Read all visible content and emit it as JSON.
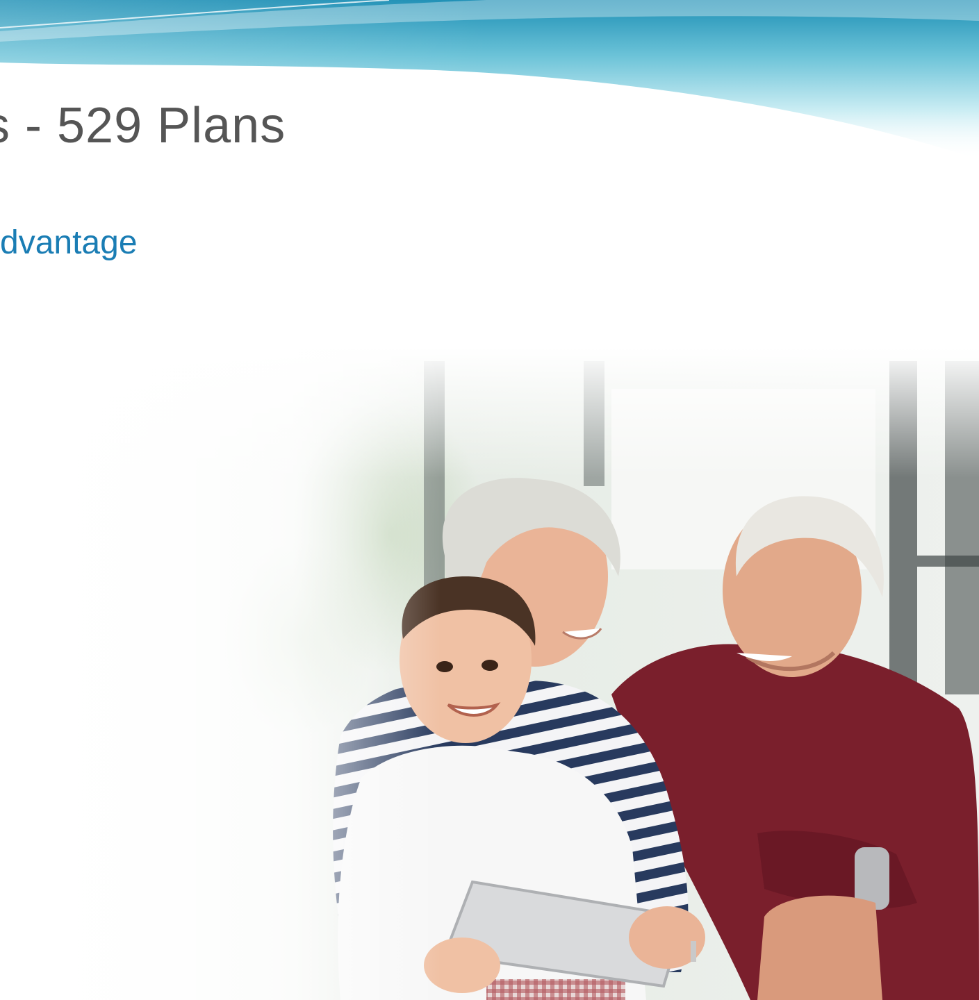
{
  "slide": {
    "title": "s - 529 Plans",
    "subtitle": "dvantage"
  },
  "colors": {
    "title": "#555555",
    "subtitle": "#1a7db4",
    "banner_dark": "#1d8fb5",
    "banner_light": "#bfe6f0"
  },
  "photo": {
    "description_icon": "family-photo"
  }
}
